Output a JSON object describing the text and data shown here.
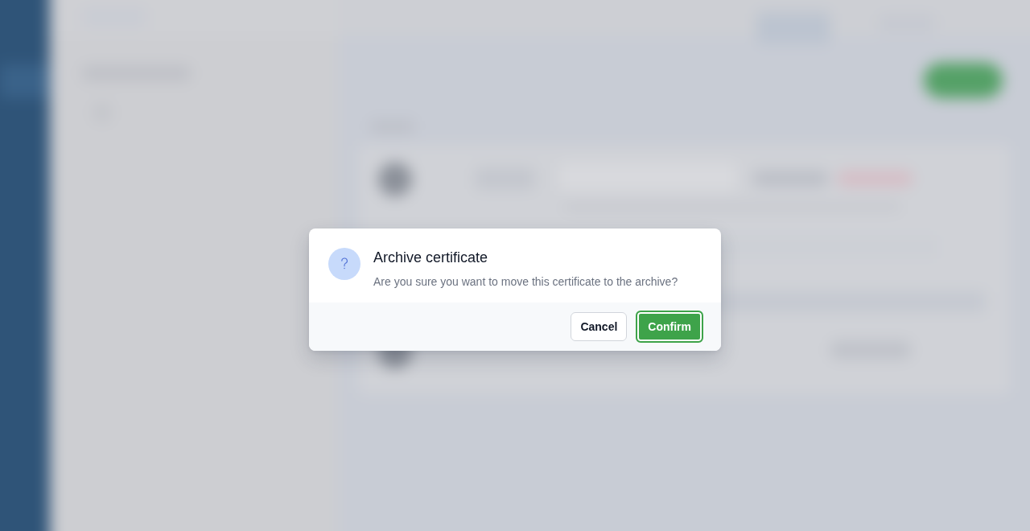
{
  "dialog": {
    "title": "Archive certificate",
    "message": "Are you sure you want to move this certificate to the archive?",
    "buttons": [
      {
        "label": "Cancel",
        "kind": "secondary",
        "focused": false
      },
      {
        "label": "Confirm",
        "kind": "primary",
        "focused": true
      }
    ]
  }
}
